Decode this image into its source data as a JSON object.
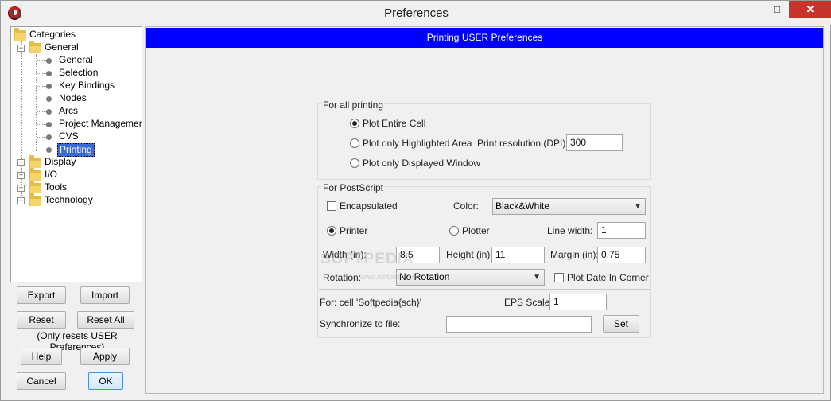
{
  "window": {
    "title": "Preferences",
    "minimize": "–",
    "maximize": "□",
    "close": "✕"
  },
  "tree": {
    "root": "Categories",
    "general": {
      "label": "General",
      "items": [
        "General",
        "Selection",
        "Key Bindings",
        "Nodes",
        "Arcs",
        "Project Management",
        "CVS",
        "Printing"
      ]
    },
    "others": [
      "Display",
      "I/O",
      "Tools",
      "Technology"
    ]
  },
  "left_buttons": {
    "export": "Export",
    "import": "Import",
    "reset": "Reset",
    "reset_all": "Reset All",
    "note": "(Only resets USER Preferences)",
    "help": "Help",
    "apply": "Apply",
    "cancel": "Cancel",
    "ok": "OK"
  },
  "panel": {
    "header": "Printing USER Preferences",
    "all_printing": {
      "title": "For all printing",
      "plot_entire": "Plot Entire Cell",
      "plot_highlighted": "Plot only Highlighted Area",
      "plot_window": "Plot only Displayed Window",
      "resolution_label": "Print resolution (DPI):",
      "resolution_value": "300"
    },
    "postscript": {
      "title": "For PostScript",
      "encapsulated": "Encapsulated",
      "color_label": "Color:",
      "color_value": "Black&White",
      "printer": "Printer",
      "plotter": "Plotter",
      "line_width_label": "Line width:",
      "line_width_value": "1",
      "width_label": "Width (in):",
      "width_value": "8.5",
      "height_label": "Height (in):",
      "height_value": "11",
      "margin_label": "Margin (in):",
      "margin_value": "0.75",
      "rotation_label": "Rotation:",
      "rotation_value": "No Rotation",
      "plot_date": "Plot Date In Corner",
      "for_cell": "For: cell 'Softpedia{sch}'",
      "eps_label": "EPS Scale:",
      "eps_value": "1",
      "sync_label": "Synchronize to file:",
      "sync_value": "",
      "set_button": "Set"
    },
    "watermark": "SOFTPEDIA",
    "watermark_url": "www.softpedia.com"
  }
}
